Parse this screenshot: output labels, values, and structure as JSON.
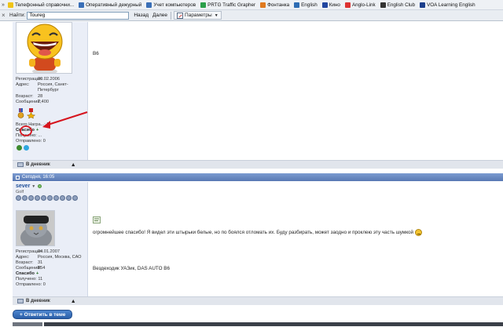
{
  "bookmarks": [
    {
      "label": "Телефонный справочни...",
      "color": "#f0c419",
      "icon": "folder-icon"
    },
    {
      "label": "Оперативный дежурный",
      "color": "#3a6fb7",
      "icon": "page-icon"
    },
    {
      "label": "Учет компьютеров",
      "color": "#3a6fb7",
      "icon": "page-icon"
    },
    {
      "label": "PRTG Traffic Grapher",
      "color": "#2b9f4a",
      "icon": "prtg-icon"
    },
    {
      "label": "Фонтанка",
      "color": "#e07a1f",
      "icon": "fontanka-icon"
    },
    {
      "label": "English",
      "color": "#2e6db4",
      "icon": "english-icon"
    },
    {
      "label": "Кино",
      "color": "#2146a0",
      "icon": "kino-icon"
    },
    {
      "label": "Anglo-Link",
      "color": "#d33",
      "icon": "anglo-icon"
    },
    {
      "label": "English Club",
      "color": "#333",
      "icon": "club-icon"
    },
    {
      "label": "VOA Learning English",
      "color": "#1b3e8c",
      "icon": "voa-icon"
    }
  ],
  "find_bar": {
    "label": "Найти:",
    "value": "Toureg",
    "back": "Назад",
    "forward": "Далее",
    "options": "Параметры"
  },
  "post1": {
    "registration_key": "Регистрация:",
    "registration_val": "20.02.2006",
    "address_key": "Адрес:",
    "address_val": "Россия, Санкт-Петербург",
    "age_key": "Возраст:",
    "age_val": "28",
    "messages_key": "Сообщений:",
    "messages_val": "7,400",
    "awards_total": "Всего Награ...: 2",
    "thanks_label": "Спасибо",
    "thanks_plus": "+",
    "received_label": "Получено: ...",
    "sent_label": "Отправлено: 0",
    "text": "B6",
    "diary": "В дневник"
  },
  "post2": {
    "date": "Сегодня, 16:05",
    "username": "sever",
    "user_title": "Golf",
    "registration_key": "Регистрация:",
    "registration_val": "24.01.2007",
    "address_key": "Адрес:",
    "address_val": "Россия, Москва, САО",
    "age_key": "Возраст:",
    "age_val": "31",
    "messages_key": "Сообщений:",
    "messages_val": "854",
    "thanks_label": "Спасибо",
    "thanks_plus": "+",
    "received_label": "Получено: 11",
    "sent_label": "Отправлено: 0",
    "text_line1": "огромнейшее спасибо! Я видел эти штырьки белые, но по боялся отломать их. Буду разбирать, может заодно и проклею эту часть шумкой",
    "text_line2": "Вездеходик УАЗик, DAS AUTO B6",
    "diary": "В дневник"
  },
  "reply_button": "+ Ответить в теме"
}
